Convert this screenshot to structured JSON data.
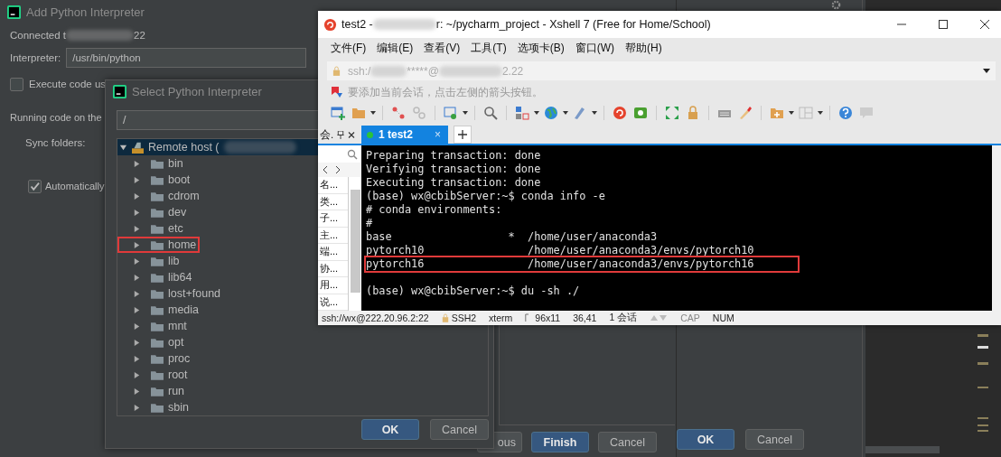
{
  "add_dialog": {
    "title": "Add Python Interpreter",
    "connected_prefix": "Connected t",
    "connected_suffix": "22",
    "interpreter_label": "Interpreter:",
    "interpreter_value": "/usr/bin/python",
    "execute_checkbox": {
      "label": "Execute code us",
      "checked": false
    },
    "running_label": "Running code on the",
    "sync_label": "Sync folders:",
    "auto_checkbox": {
      "label": "Automatically",
      "checked": true
    },
    "buttons": [
      {
        "label": "ous",
        "kind": "default"
      },
      {
        "label": "Finish",
        "kind": "primary"
      },
      {
        "label": "Cancel",
        "kind": "default"
      }
    ]
  },
  "back_dialog": {
    "buttons": [
      {
        "label": "OK",
        "kind": "primary"
      },
      {
        "label": "Cancel",
        "kind": "default"
      }
    ]
  },
  "select_dialog": {
    "title": "Select Python Interpreter",
    "path_value": "/",
    "tree": {
      "label": "Remote host (",
      "expanded": true,
      "selected": true,
      "children": [
        {
          "label": "bin",
          "expanded": false,
          "highlighted": false
        },
        {
          "label": "boot",
          "expanded": false,
          "highlighted": false
        },
        {
          "label": "cdrom",
          "expanded": false,
          "highlighted": false
        },
        {
          "label": "dev",
          "expanded": false,
          "highlighted": false
        },
        {
          "label": "etc",
          "expanded": false,
          "highlighted": false
        },
        {
          "label": "home",
          "expanded": false,
          "highlighted": true
        },
        {
          "label": "lib",
          "expanded": false,
          "highlighted": false
        },
        {
          "label": "lib64",
          "expanded": false,
          "highlighted": false
        },
        {
          "label": "lost+found",
          "expanded": false,
          "highlighted": false
        },
        {
          "label": "media",
          "expanded": false,
          "highlighted": false
        },
        {
          "label": "mnt",
          "expanded": false,
          "highlighted": false
        },
        {
          "label": "opt",
          "expanded": false,
          "highlighted": false
        },
        {
          "label": "proc",
          "expanded": false,
          "highlighted": false
        },
        {
          "label": "root",
          "expanded": false,
          "highlighted": false
        },
        {
          "label": "run",
          "expanded": false,
          "highlighted": false
        },
        {
          "label": "sbin",
          "expanded": false,
          "highlighted": false
        }
      ]
    },
    "buttons": [
      {
        "label": "OK",
        "kind": "primary"
      },
      {
        "label": "Cancel",
        "kind": "default"
      }
    ]
  },
  "xshell": {
    "title_prefix": "test2 - ",
    "title_suffix": "r: ~/pycharm_project - Xshell 7 (Free for Home/School)",
    "menu": [
      "文件(F)",
      "编辑(E)",
      "查看(V)",
      "工具(T)",
      "选项卡(B)",
      "窗口(W)",
      "帮助(H)"
    ],
    "address_prefix": "ssh:/",
    "address_middle": "*****@",
    "address_suffix": "2.22",
    "hint": "要添加当前会话，点击左侧的箭头按钮。",
    "session_panel": {
      "title": "会.",
      "items": [
        "名...",
        "类...",
        "子...",
        "主...",
        "端...",
        "协...",
        "用...",
        "说..."
      ]
    },
    "tabs": [
      {
        "label": "1 test2",
        "close": "×",
        "selected": true
      }
    ],
    "terminal": [
      {
        "text": "Preparing transaction: done",
        "highlighted": false
      },
      {
        "text": "Verifying transaction: done",
        "highlighted": false
      },
      {
        "text": "Executing transaction: done",
        "highlighted": false
      },
      {
        "text": "(base) wx@cbibServer:~$ conda info -e",
        "highlighted": false
      },
      {
        "text": "# conda environments:",
        "highlighted": false
      },
      {
        "text": "#",
        "highlighted": false
      },
      {
        "text": "base                  *  /home/user/anaconda3",
        "highlighted": false
      },
      {
        "text": "pytorch10                /home/user/anaconda3/envs/pytorch10",
        "highlighted": false
      },
      {
        "text": "pytorch16                /home/user/anaconda3/envs/pytorch16",
        "highlighted": true
      },
      {
        "text": "(base) wx@cbibServer:~$ du -sh ./",
        "highlighted": false,
        "blank_before": true
      }
    ],
    "status": [
      {
        "text": "ssh://wx@222.20.96.2:22",
        "kind": "plain"
      },
      {
        "text": "SSH2",
        "kind": "secure"
      },
      {
        "text": "xterm",
        "kind": "plain"
      },
      {
        "text": "96x11",
        "kind": "size"
      },
      {
        "text": "36,41",
        "kind": "plain"
      },
      {
        "text": "1 会话",
        "kind": "plain"
      },
      {
        "kind": "arrows"
      },
      {
        "text": "CAP",
        "kind": "dim"
      },
      {
        "text": "NUM",
        "kind": "plain"
      }
    ]
  }
}
